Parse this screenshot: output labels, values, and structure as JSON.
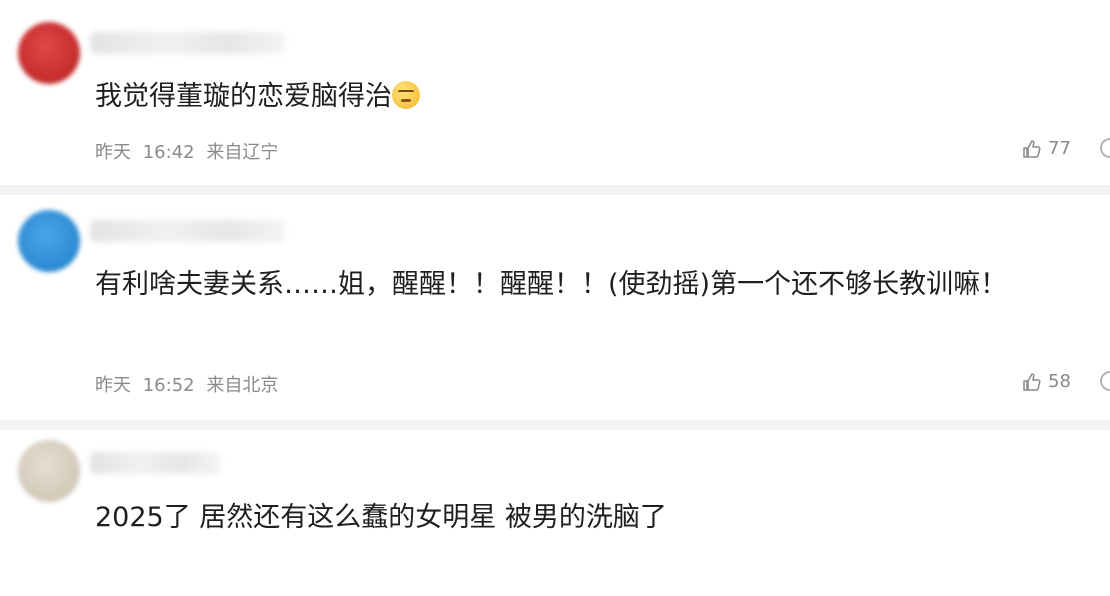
{
  "comments": [
    {
      "content": "我觉得董璇的恋爱脑得治",
      "emoji_icon": "smirk-emoji-icon",
      "date": "昨天",
      "time": "16:42",
      "location": "来自辽宁",
      "likes": "77",
      "avatar_color": "#cc2a2a"
    },
    {
      "content": "有利啥夫妻关系……姐，醒醒！！醒醒！！(使劲摇)第一个还不够长教训嘛！",
      "date": "昨天",
      "time": "16:52",
      "location": "来自北京",
      "likes": "58",
      "avatar_color": "#2f8fd8"
    },
    {
      "content": "2025了 居然还有这么蠢的女明星 被男的洗脑了",
      "avatar_color": "#d8cfc0"
    }
  ],
  "colors": {
    "meta_text": "#8a8a8a",
    "divider": "#f3f3f3"
  }
}
